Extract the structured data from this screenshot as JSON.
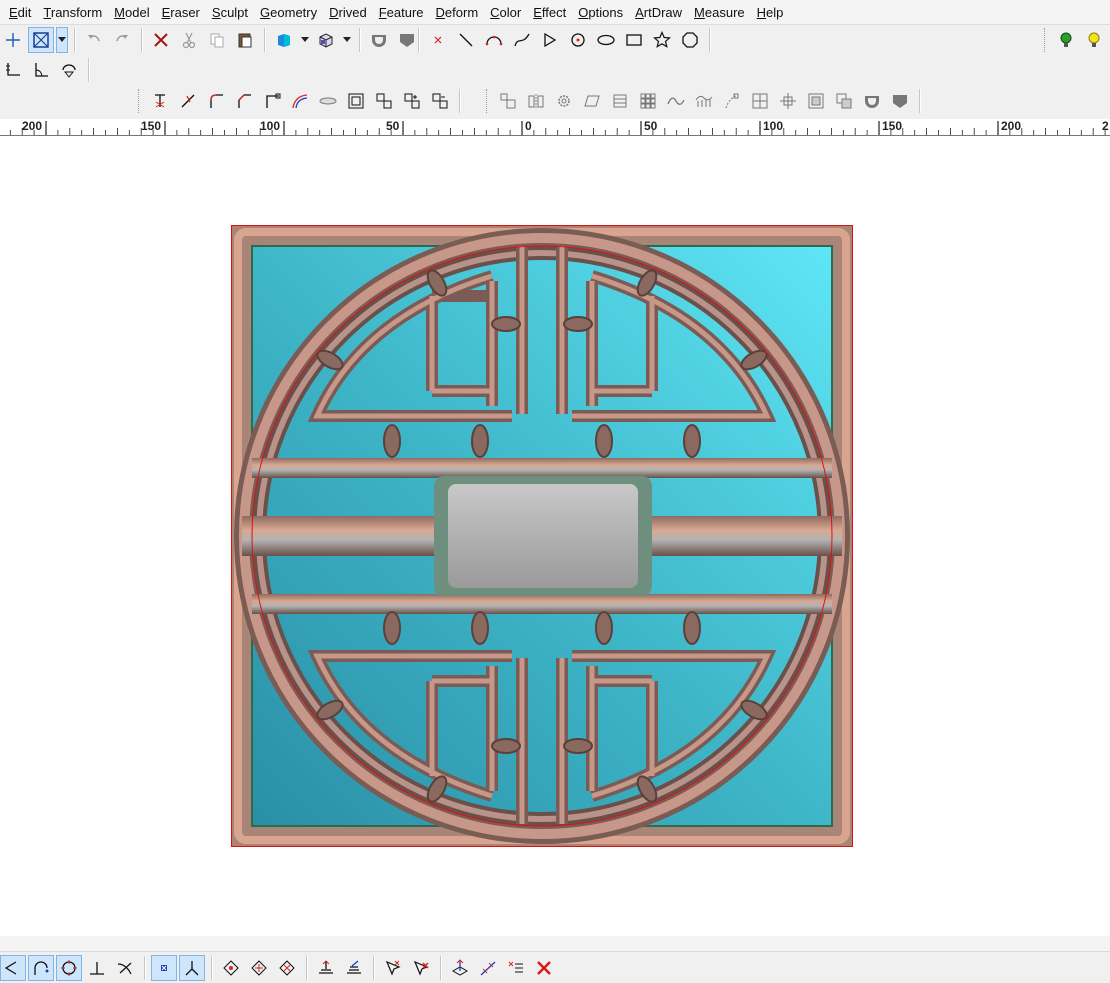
{
  "menu": [
    "Edit",
    "Transform",
    "Model",
    "Eraser",
    "Sculpt",
    "Geometry",
    "Drived",
    "Feature",
    "Deform",
    "Color",
    "Effect",
    "Options",
    "ArtDraw",
    "Measure",
    "Help"
  ],
  "menu_underline": [
    "E",
    "T",
    "M",
    "E",
    "S",
    "G",
    "D",
    "F",
    "D",
    "C",
    "E",
    "O",
    "A",
    "M",
    "H"
  ],
  "toolbars": {
    "row1_left": [
      "crosshair-icon",
      "select-box-icon",
      "dropdown-arrow-icon",
      "undo-icon",
      "redo-icon",
      "delete-icon",
      "cut-icon",
      "copy-icon",
      "paste-icon",
      "shade-mode-icon",
      "dropdown-arrow-icon",
      "view-cube-icon",
      "dropdown-arrow-icon",
      "relief-round-icon",
      "relief-flat-icon"
    ],
    "row1_draw": [
      "point-icon",
      "line-icon",
      "arc-icon",
      "curve-icon",
      "polyline-icon",
      "circle-center-icon",
      "ellipse-icon",
      "rectangle-icon",
      "star-icon",
      "polygon-icon"
    ],
    "row1_right": [
      "green-light-icon",
      "yellow-light-icon"
    ],
    "row2": [
      "axis-icon",
      "angle-icon",
      "rotate-view-icon"
    ],
    "row3_a": [
      "trim-icon",
      "extend-icon",
      "fillet-icon",
      "chamfer-icon",
      "corner-icon",
      "offset-curve-icon",
      "flat-ellipse-icon",
      "frame-icon",
      "node-edit-icon",
      "node-add-icon",
      "node-delete-icon"
    ],
    "row3_b": [
      "align-icon",
      "mirror-icon",
      "gear-icon",
      "skew-icon",
      "stack-icon",
      "array-icon",
      "wave-icon",
      "wave-array-icon",
      "path-icon",
      "grid-icon",
      "explode-icon",
      "group-icon",
      "ungroup-icon",
      "relief-round-icon",
      "relief-flat-icon"
    ],
    "snap": [
      "tangent-snap-icon",
      "arc-snap-icon",
      "circle-snap-icon",
      "perpendicular-snap-icon",
      "intersect-snap-icon",
      "grid-snap-icon",
      "angle-snap-icon",
      "diamond-a-icon",
      "diamond-b-icon",
      "diamond-c-icon",
      "layer-a-icon",
      "layer-b-icon",
      "pick-a-icon",
      "pick-b-icon",
      "transform-a-icon",
      "transform-b-icon",
      "list-icon",
      "close-x-icon"
    ]
  },
  "ruler": {
    "labels": [
      "200",
      "150",
      "100",
      "50",
      "0",
      "50",
      "100",
      "150",
      "200",
      "2"
    ],
    "origin_value": 0,
    "step_value": 50
  },
  "colors": {
    "relief_teal": "#3fb7c9",
    "relief_copper": "#c98a72",
    "selection_red": "#dd1111",
    "menu_bg": "#f4f4f4"
  }
}
